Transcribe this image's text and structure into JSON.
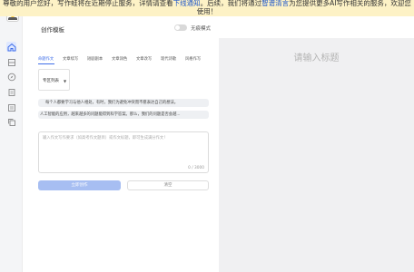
{
  "banner": {
    "part1": "尊敬的用户您好，写作蛙将在近期停止服务，详情请查看",
    "link1": "下线通知",
    "part2": "。后续，我们将通过",
    "link2": "智谱清言",
    "part3": "为您提供更多AI写作相关的服务，欢迎您使用！"
  },
  "sidebar": {
    "icons": [
      "home-icon",
      "grid-icon",
      "compass-icon",
      "document-icon",
      "list-icon",
      "copy-icon"
    ]
  },
  "header": {
    "title": "创作模板",
    "toggle_label": "无痕模式",
    "toggle_on": false
  },
  "tabs": [
    {
      "label": "命题作文",
      "active": true
    },
    {
      "label": "文章续写",
      "active": false
    },
    {
      "label": "短剧剧本",
      "active": false
    },
    {
      "label": "文章润色",
      "active": false
    },
    {
      "label": "文章改写",
      "active": false
    },
    {
      "label": "现代诗歌",
      "active": false
    },
    {
      "label": "风格作写",
      "active": false
    }
  ],
  "dropdown": {
    "value": "专区列表"
  },
  "suggestions": [
    "每个人都要学习与他人相处，有时，我们为避免冲突而不愿表达自己的想法。",
    "人工智能的应用，越来越多的问题能得到科学答案。那么，我们的问题是否会越..."
  ],
  "textarea": {
    "placeholder": "输入作文写作要求（如高考作文题目）或作文标题，即可生成满分作文！",
    "counter": "0 / 3000"
  },
  "buttons": {
    "generate": "立即创作",
    "clear": "清空"
  },
  "preview": {
    "title_placeholder": "请输入标题"
  },
  "colors": {
    "accent": "#3f6ee8",
    "banner_bg": "#fdf2c6",
    "link": "#1e56c9",
    "primary_button": "#a7bef2"
  }
}
